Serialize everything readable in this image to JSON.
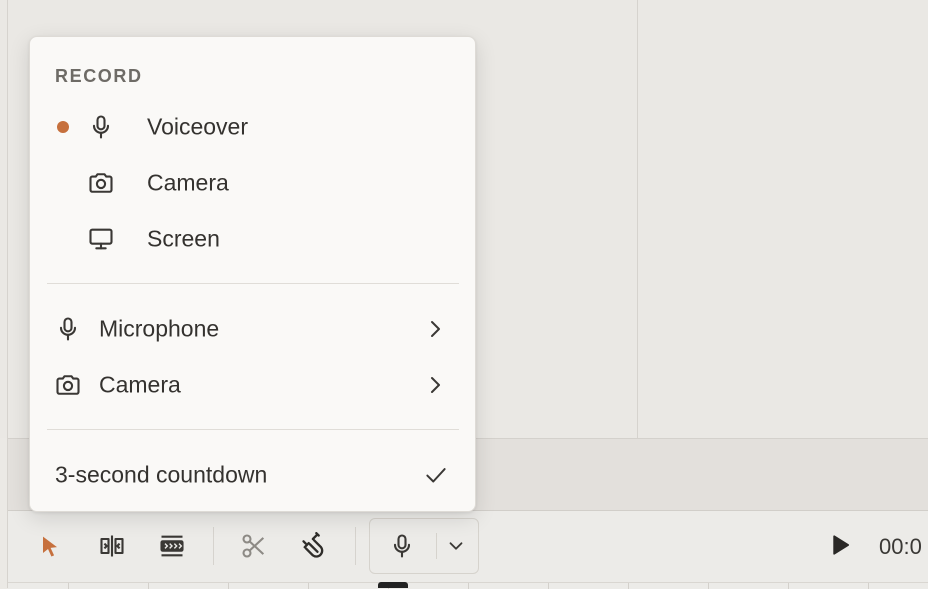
{
  "menu": {
    "heading": "RECORD",
    "record_items": [
      {
        "label": "Voiceover",
        "icon": "microphone-icon",
        "active": true
      },
      {
        "label": "Camera",
        "icon": "camera-icon",
        "active": false
      },
      {
        "label": "Screen",
        "icon": "monitor-icon",
        "active": false
      }
    ],
    "device_items": [
      {
        "label": "Microphone",
        "icon": "microphone-icon",
        "submenu": true
      },
      {
        "label": "Camera",
        "icon": "camera-icon",
        "submenu": true
      }
    ],
    "countdown": {
      "label": "3-second countdown",
      "checked": true
    }
  },
  "toolbar": {
    "tools": [
      "pointer-icon",
      "split-clip-icon",
      "trim-icon",
      "scissors-icon",
      "magnet-icon"
    ],
    "record_button": "microphone-icon",
    "record_dropdown": "chevron-down-icon",
    "play_button": "play-icon",
    "time_display": "00:0"
  },
  "colors": {
    "accent": "#c6703d",
    "menu_bg": "#faf9f7",
    "app_bg": "#ebe9e5"
  }
}
